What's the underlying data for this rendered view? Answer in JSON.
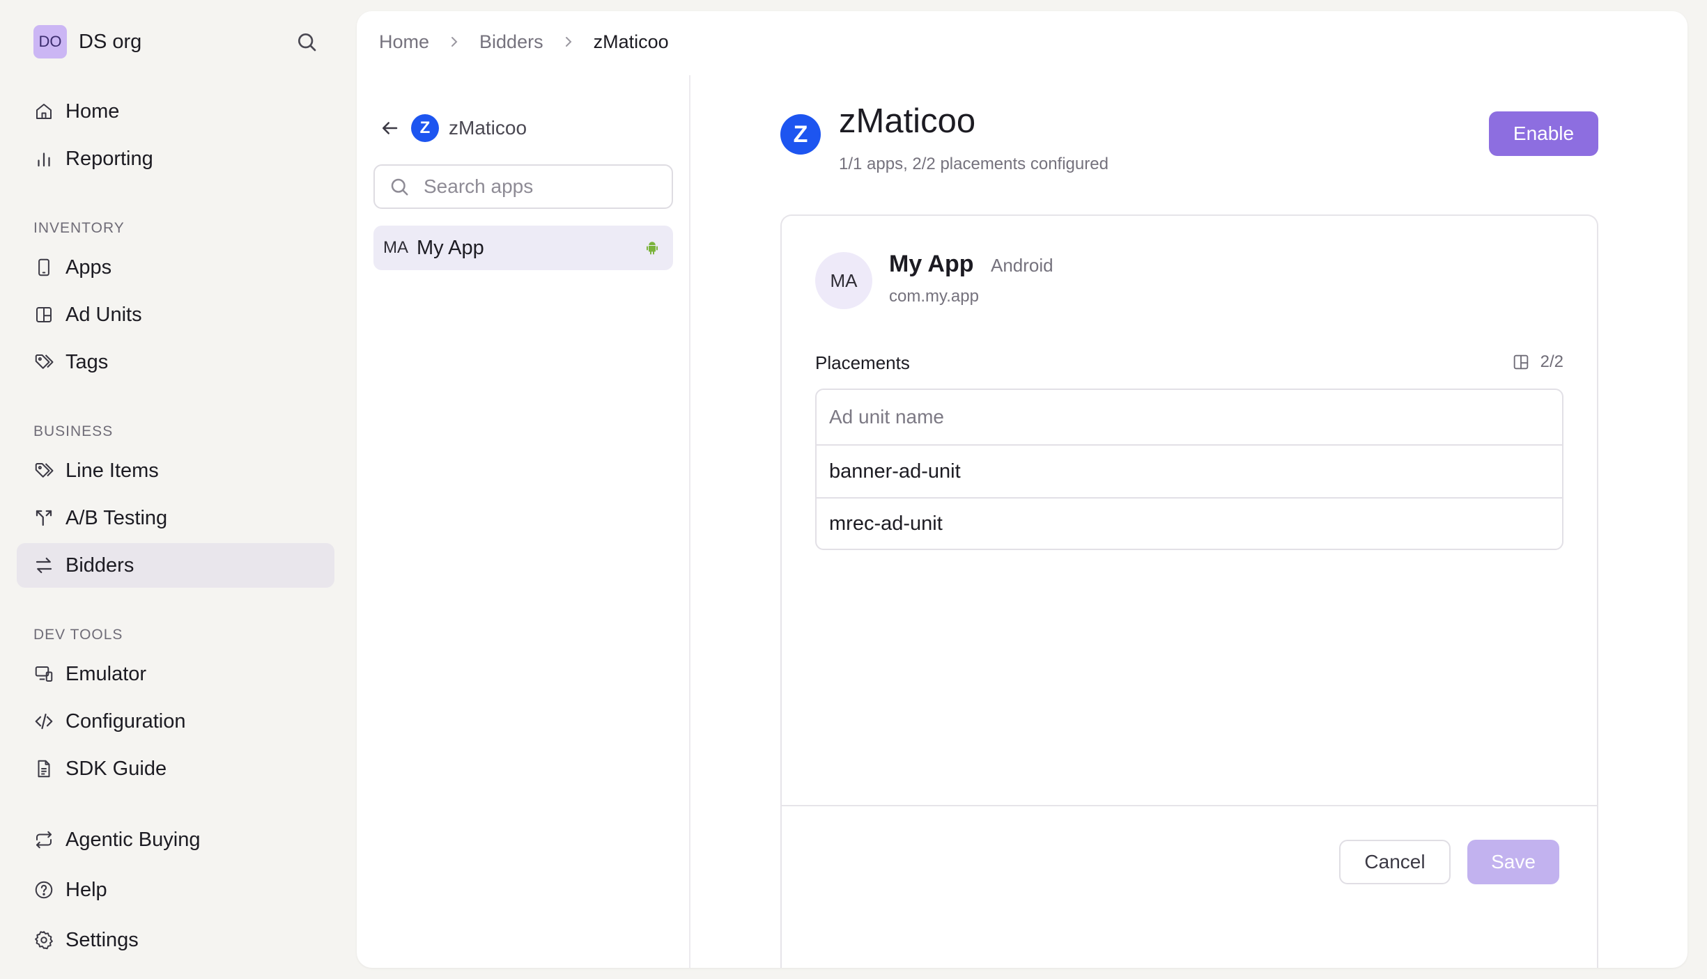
{
  "org": {
    "avatar": "DO",
    "name": "DS org"
  },
  "nav": {
    "home": "Home",
    "reporting": "Reporting",
    "inventory_label": "INVENTORY",
    "apps": "Apps",
    "ad_units": "Ad Units",
    "tags": "Tags",
    "business_label": "BUSINESS",
    "line_items": "Line Items",
    "ab_testing": "A/B Testing",
    "bidders": "Bidders",
    "devtools_label": "DEV TOOLS",
    "emulator": "Emulator",
    "configuration": "Configuration",
    "sdk_guide": "SDK Guide",
    "agentic_buying": "Agentic Buying",
    "help": "Help",
    "settings": "Settings",
    "active": "bidders"
  },
  "breadcrumb": [
    "Home",
    "Bidders",
    "zMaticoo"
  ],
  "app_list": {
    "bidder_name": "zMaticoo",
    "bidder_logo_letter": "Z",
    "search_placeholder": "Search apps",
    "items": [
      {
        "abbr": "MA",
        "name": "My App",
        "platform_icon": "android-icon"
      }
    ]
  },
  "detail": {
    "logo_letter": "Z",
    "title": "zMaticoo",
    "subtitle": "1/1 apps, 2/2 placements configured",
    "enable_label": "Enable",
    "app": {
      "avatar": "MA",
      "name": "My App",
      "platform": "Android",
      "bundle": "com.my.app"
    },
    "placements_label": "Placements",
    "placements_count": "2/2",
    "table_header": "Ad unit name",
    "ad_units": [
      "banner-ad-unit",
      "mrec-ad-unit"
    ],
    "cancel_label": "Cancel",
    "save_label": "Save"
  },
  "colors": {
    "accent": "#8d6ee0",
    "accent_disabled": "#c2b2ef",
    "bidder_brand": "#1d55f0",
    "android_green": "#7bb33c"
  }
}
